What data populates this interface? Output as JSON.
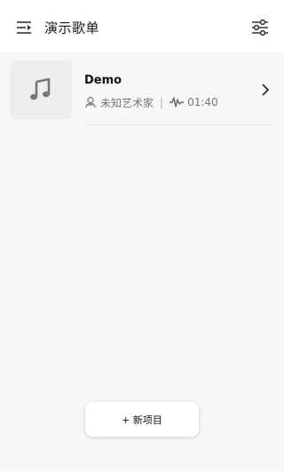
{
  "header": {
    "title": "演示歌单",
    "menu_icon": "playlist-menu-icon",
    "filter_icon": "sliders-icon"
  },
  "songs": [
    {
      "title": "Demo",
      "artist": "未知艺术家",
      "separator": "|",
      "duration": "01:40",
      "art_icon": "music-note-icon",
      "artist_icon": "artist-icon",
      "duration_icon": "waveform-icon"
    }
  ],
  "new_item_button": {
    "label": "+ 新项目"
  },
  "colors": {
    "background": "#f7f7f7",
    "header_bg": "#ffffff",
    "art_bg": "#eeeeee",
    "meta_text": "#777777"
  }
}
